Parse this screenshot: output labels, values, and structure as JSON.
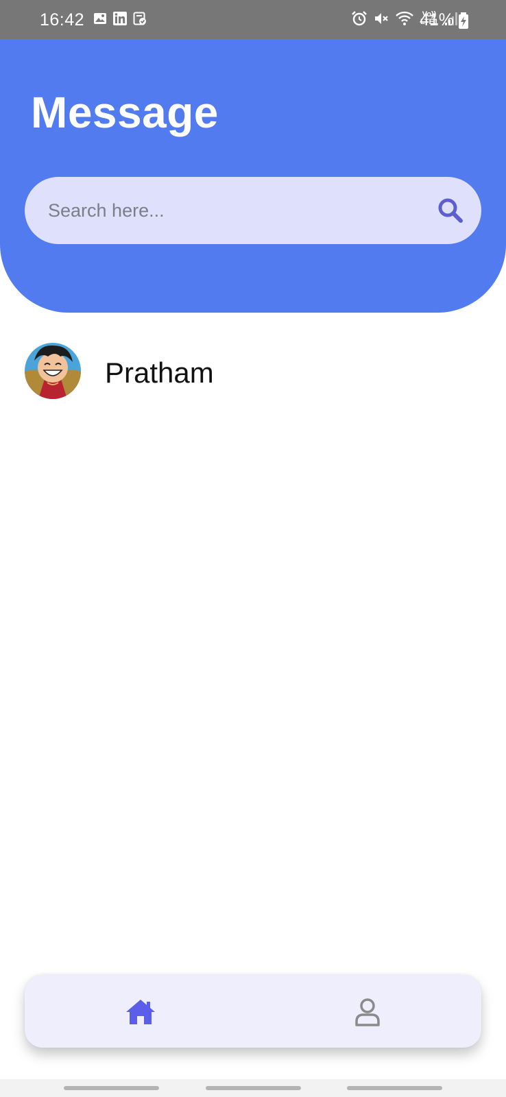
{
  "status_bar": {
    "time": "16:42",
    "battery": "41%",
    "left_icons": [
      "gallery-icon",
      "linkedin-icon",
      "clipboard-check-icon"
    ],
    "right_icons": [
      "alarm-icon",
      "mute-icon",
      "wifi-icon",
      "volte-lte-icon",
      "signal-icon",
      "battery-charging-icon"
    ],
    "volte_label": "Vo)) LTE1"
  },
  "header": {
    "title": "Message",
    "background_color": "#517bef"
  },
  "search": {
    "placeholder": "Search here...",
    "value": "",
    "icon": "search-icon",
    "background_color": "#dfe0fb"
  },
  "contacts": [
    {
      "name": "Pratham",
      "avatar": "avatar-image"
    }
  ],
  "bottom_nav": {
    "items": [
      {
        "icon": "home-icon",
        "active": true
      },
      {
        "icon": "profile-icon",
        "active": false
      }
    ],
    "active_color": "#5a5ee8",
    "inactive_color": "#8a8a8a"
  }
}
